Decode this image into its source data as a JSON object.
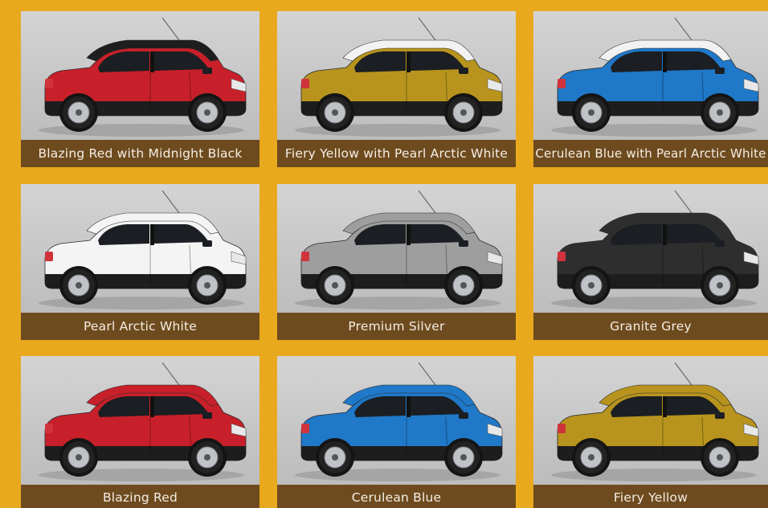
{
  "page": {
    "background": "#E9A91F",
    "caption_bg": "#6E4B1F"
  },
  "colors": [
    {
      "label": "Blazing Red with Midnight Black",
      "body": "#C8202A",
      "roof": "#1E1E1E"
    },
    {
      "label": "Fiery Yellow with Pearl Arctic White",
      "body": "#B8941E",
      "roof": "#F2F2F2"
    },
    {
      "label": "Cerulean Blue with Pearl Arctic White",
      "body": "#1F78C8",
      "roof": "#F2F2F2"
    },
    {
      "label": "Pearl Arctic White",
      "body": "#F4F4F4",
      "roof": "#F4F4F4"
    },
    {
      "label": "Premium Silver",
      "body": "#9E9E9E",
      "roof": "#9E9E9E"
    },
    {
      "label": "Granite Grey",
      "body": "#2E2E2E",
      "roof": "#2E2E2E"
    },
    {
      "label": "Blazing Red",
      "body": "#C8202A",
      "roof": "#C8202A"
    },
    {
      "label": "Cerulean Blue",
      "body": "#1F78C8",
      "roof": "#1F78C8"
    },
    {
      "label": "Fiery Yellow",
      "body": "#B8941E",
      "roof": "#B8941E"
    }
  ]
}
